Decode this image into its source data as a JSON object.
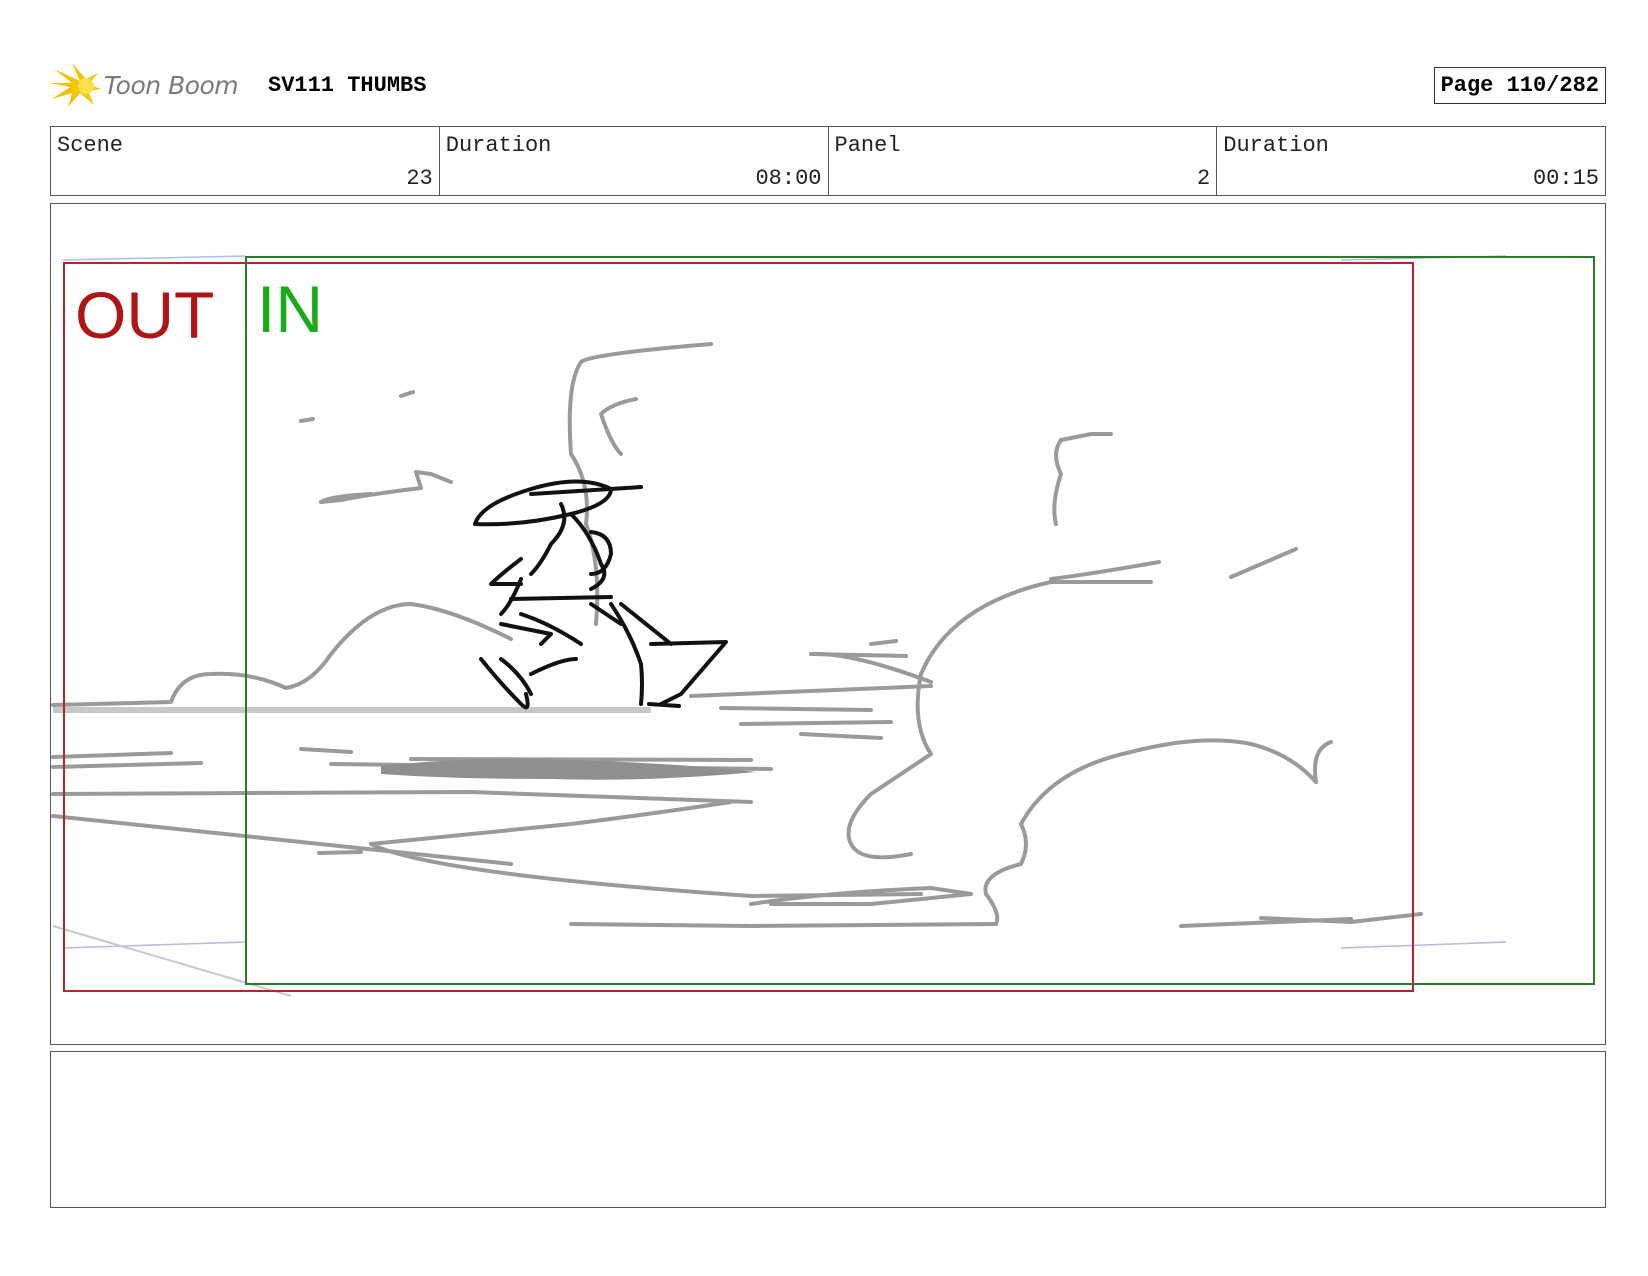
{
  "header": {
    "logo_text": "Toon Boom",
    "title": "SV111 THUMBS",
    "page": "Page 110/282"
  },
  "info": {
    "scene_label": "Scene",
    "scene_value": "23",
    "scene_duration_label": "Duration",
    "scene_duration_value": "08:00",
    "panel_label": "Panel",
    "panel_value": "2",
    "panel_duration_label": "Duration",
    "panel_duration_value": "00:15"
  },
  "frame": {
    "out_label": "OUT",
    "in_label": "IN",
    "out_color": "#c0202a",
    "in_color": "#2b7a2b"
  },
  "notes": {
    "text": ""
  }
}
